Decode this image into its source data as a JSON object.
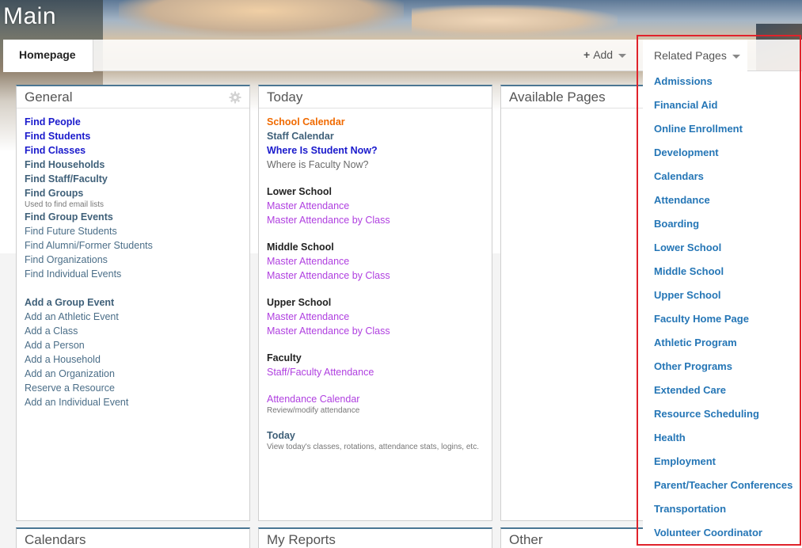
{
  "page": {
    "title": "Main"
  },
  "tabs": {
    "homepage": "Homepage"
  },
  "toolbar": {
    "add_label": "Add",
    "related_label": "Related Pages"
  },
  "panels": {
    "general": {
      "title": "General",
      "find": [
        "Find People",
        "Find Students",
        "Find Classes",
        "Find Households",
        "Find Staff/Faculty",
        "Find Groups"
      ],
      "find_groups_note": "Used to find email lists",
      "find2": [
        "Find Group Events",
        "Find Future Students",
        "Find Alumni/Former Students",
        "Find Organizations",
        "Find Individual Events"
      ],
      "add": [
        "Add a Group Event",
        "Add an Athletic Event",
        "Add a Class",
        "Add a Person",
        "Add a Household",
        "Add an Organization",
        "Reserve a Resource",
        "Add an Individual Event"
      ]
    },
    "today": {
      "title": "Today",
      "top": [
        "School Calendar",
        "Staff Calendar",
        "Where Is Student Now?",
        "Where is Faculty Now?"
      ],
      "lower_school": "Lower School",
      "middle_school": "Middle School",
      "upper_school": "Upper School",
      "master_attendance": "Master Attendance",
      "master_attendance_by_class": "Master Attendance by Class",
      "faculty": "Faculty",
      "staff_faculty_attendance": "Staff/Faculty Attendance",
      "attendance_calendar": "Attendance Calendar",
      "attendance_calendar_note": "Review/modify attendance",
      "today_link": "Today",
      "today_note": "View today's classes, rotations, attendance stats, logins, etc."
    },
    "available": {
      "title": "Available Pages"
    },
    "calendars": {
      "title": "Calendars"
    },
    "reports": {
      "title": "My Reports"
    },
    "other": {
      "title": "Other"
    }
  },
  "related_pages": [
    "Admissions",
    "Financial Aid",
    "Online Enrollment",
    "Development",
    "Calendars",
    "Attendance",
    "Boarding",
    "Lower School",
    "Middle School",
    "Upper School",
    "Faculty Home Page",
    "Athletic Program",
    "Other Programs",
    "Extended Care",
    "Resource Scheduling",
    "Health",
    "Employment",
    "Parent/Teacher Conferences",
    "Transportation",
    "Volunteer Coordinator"
  ],
  "colors": {
    "accent": "#4b7693",
    "link": "#2576b6",
    "highlight": "#e0232b"
  }
}
